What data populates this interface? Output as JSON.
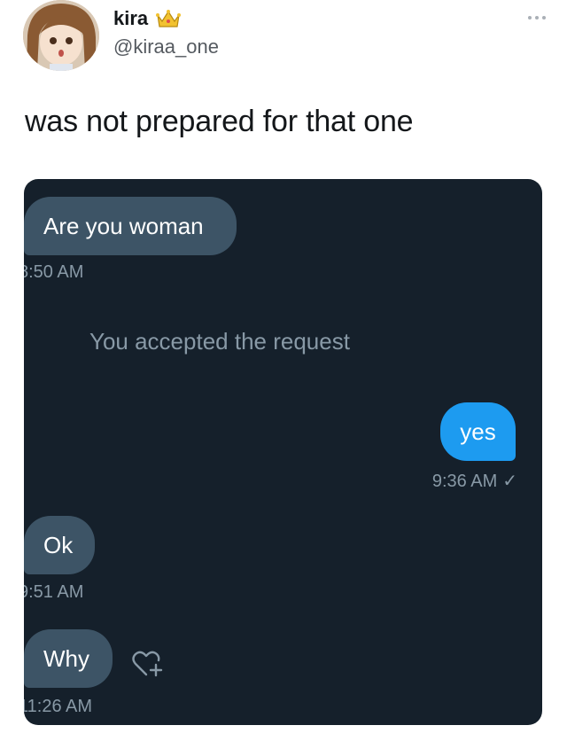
{
  "tweet": {
    "display_name": "kira",
    "handle": "@kiraa_one",
    "text": "was not prepared for that one",
    "badge_icon": "crown-icon",
    "more_icon": "more-dots-icon"
  },
  "dm": {
    "background_color": "#15202b",
    "incoming_color": "#3d5466",
    "outgoing_color": "#1d9bf0",
    "messages": [
      {
        "direction": "incoming",
        "text": "Are you woman",
        "time": "8:50 AM"
      },
      {
        "direction": "system",
        "text": "You accepted the request"
      },
      {
        "direction": "outgoing",
        "text": "yes",
        "time": "9:36 AM",
        "status_icon": "check-icon"
      },
      {
        "direction": "incoming",
        "text": "Ok",
        "time": "9:51 AM"
      },
      {
        "direction": "incoming",
        "text": "Why",
        "time": "11:26 AM",
        "reaction_icon": "add-reaction-heart-icon"
      }
    ]
  }
}
